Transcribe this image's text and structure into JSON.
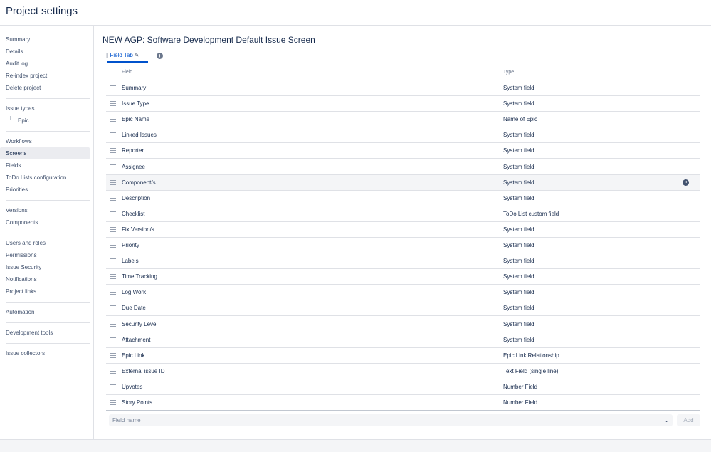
{
  "header": {
    "title": "Project settings"
  },
  "sidebar": {
    "groups": [
      [
        "Summary",
        "Details",
        "Audit log",
        "Re-index project",
        "Delete project"
      ],
      [
        "Issue types",
        "Epic"
      ],
      [
        "Workflows",
        "Screens",
        "Fields",
        "ToDo Lists configuration",
        "Priorities"
      ],
      [
        "Versions",
        "Components"
      ],
      [
        "Users and roles",
        "Permissions",
        "Issue Security",
        "Notifications",
        "Project links"
      ],
      [
        "Automation"
      ],
      [
        "Development tools"
      ],
      [
        "Issue collectors"
      ]
    ],
    "active": "Screens",
    "sub_items": [
      "Epic"
    ]
  },
  "main": {
    "title": "NEW AGP: Software Development Default Issue Screen",
    "tab_label": "Field Tab",
    "columns": {
      "field": "Field",
      "type": "Type"
    },
    "rows": [
      {
        "field": "Summary",
        "type": "System field"
      },
      {
        "field": "Issue Type",
        "type": "System field"
      },
      {
        "field": "Epic Name",
        "type": "Name of Epic"
      },
      {
        "field": "Linked Issues",
        "type": "System field"
      },
      {
        "field": "Reporter",
        "type": "System field"
      },
      {
        "field": "Assignee",
        "type": "System field"
      },
      {
        "field": "Component/s",
        "type": "System field",
        "highlighted": true
      },
      {
        "field": "Description",
        "type": "System field"
      },
      {
        "field": "Checklist",
        "type": "ToDo List custom field"
      },
      {
        "field": "Fix Version/s",
        "type": "System field"
      },
      {
        "field": "Priority",
        "type": "System field"
      },
      {
        "field": "Labels",
        "type": "System field"
      },
      {
        "field": "Time Tracking",
        "type": "System field"
      },
      {
        "field": "Log Work",
        "type": "System field"
      },
      {
        "field": "Due Date",
        "type": "System field"
      },
      {
        "field": "Security Level",
        "type": "System field"
      },
      {
        "field": "Attachment",
        "type": "System field"
      },
      {
        "field": "Epic Link",
        "type": "Epic Link Relationship"
      },
      {
        "field": "External issue ID",
        "type": "Text Field (single line)"
      },
      {
        "field": "Upvotes",
        "type": "Number Field"
      },
      {
        "field": "Story Points",
        "type": "Number Field"
      }
    ],
    "field_select_placeholder": "Field name",
    "add_label": "Add"
  },
  "icons": {
    "tab_grip": "grip-icon",
    "tab_edit": "pencil-icon",
    "add_tab": "plus-circle-icon",
    "drag": "drag-handle-icon",
    "remove": "remove-circle-icon",
    "select": "chevron-down-icon"
  },
  "colors": {
    "accent": "#0052cc",
    "text": "#172b4d",
    "active_nav_bg": "#ebecf0",
    "highlight_row_bg": "#f4f5f7"
  }
}
